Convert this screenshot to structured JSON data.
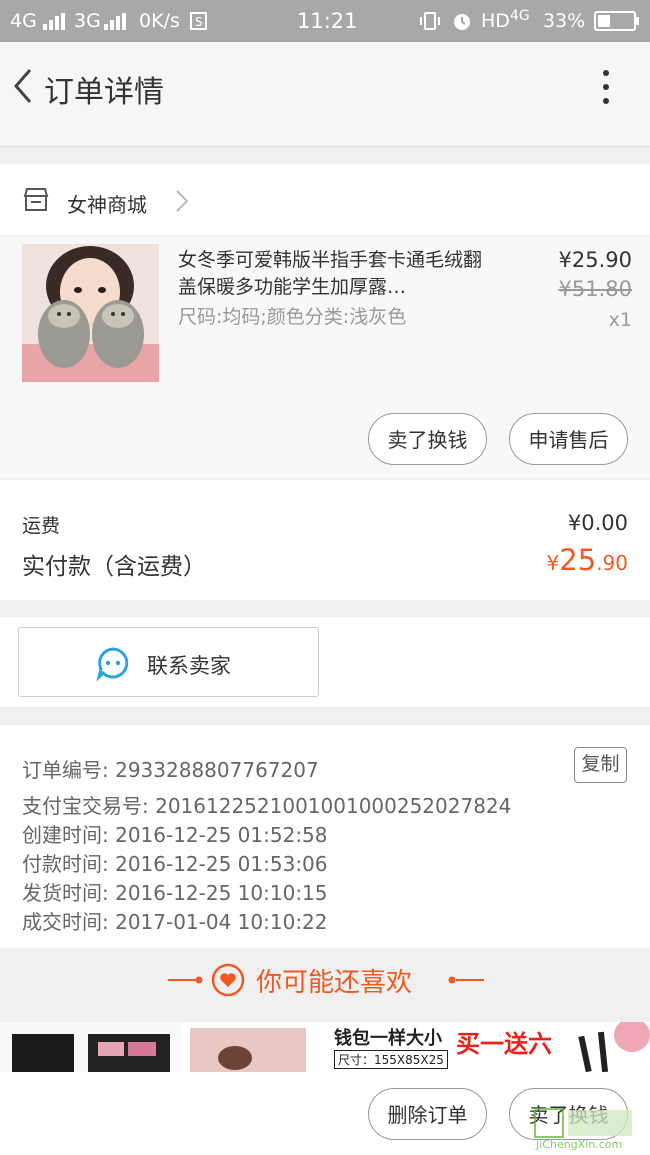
{
  "status_bar": {
    "network1": "4G",
    "network2": "3G",
    "speed": "0K/s",
    "time": "11:21",
    "hd": "HD",
    "hd_net": "4G",
    "battery": "33%"
  },
  "nav": {
    "title": "订单详情"
  },
  "shop": {
    "name": "女神商城"
  },
  "product": {
    "title": "女冬季可爱韩版半指手套卡通毛绒翻盖保暖多功能学生加厚露…",
    "spec": "尺码:均码;颜色分类:浅灰色",
    "price": "¥25.90",
    "original_price": "¥51.80",
    "quantity": "x1"
  },
  "item_actions": {
    "resell": "卖了换钱",
    "after_sale": "申请售后"
  },
  "payment": {
    "shipping_label": "运费",
    "shipping_value": "¥0.00",
    "paid_label": "实付款（含运费）",
    "paid_currency": "¥",
    "paid_int": "25",
    "paid_dec": ".90"
  },
  "contact": {
    "label": "联系卖家"
  },
  "order_info": {
    "copy_label": "复制",
    "lines": [
      "订单编号: 2933288807767207",
      "支付宝交易号: 2016122521001001000252027824",
      "创建时间: 2016-12-25 01:52:58",
      "付款时间: 2016-12-25 01:53:06",
      "发货时间: 2016-12-25 10:10:15",
      "成交时间: 2017-01-04 10:10:22"
    ]
  },
  "recommend": {
    "title": "你可能还喜欢",
    "banner_text1": "钱包一样大小",
    "banner_text2": "买一送六",
    "banner_size": "尺寸：155X85X25"
  },
  "bottom_actions": {
    "delete": "删除订单",
    "resell": "卖了换钱"
  },
  "watermark": {
    "text": "JiChengXin.com"
  },
  "colors": {
    "accent": "#f05a22",
    "contact_icon": "#2aa4e0",
    "status_bar": "#a8a8a8"
  }
}
